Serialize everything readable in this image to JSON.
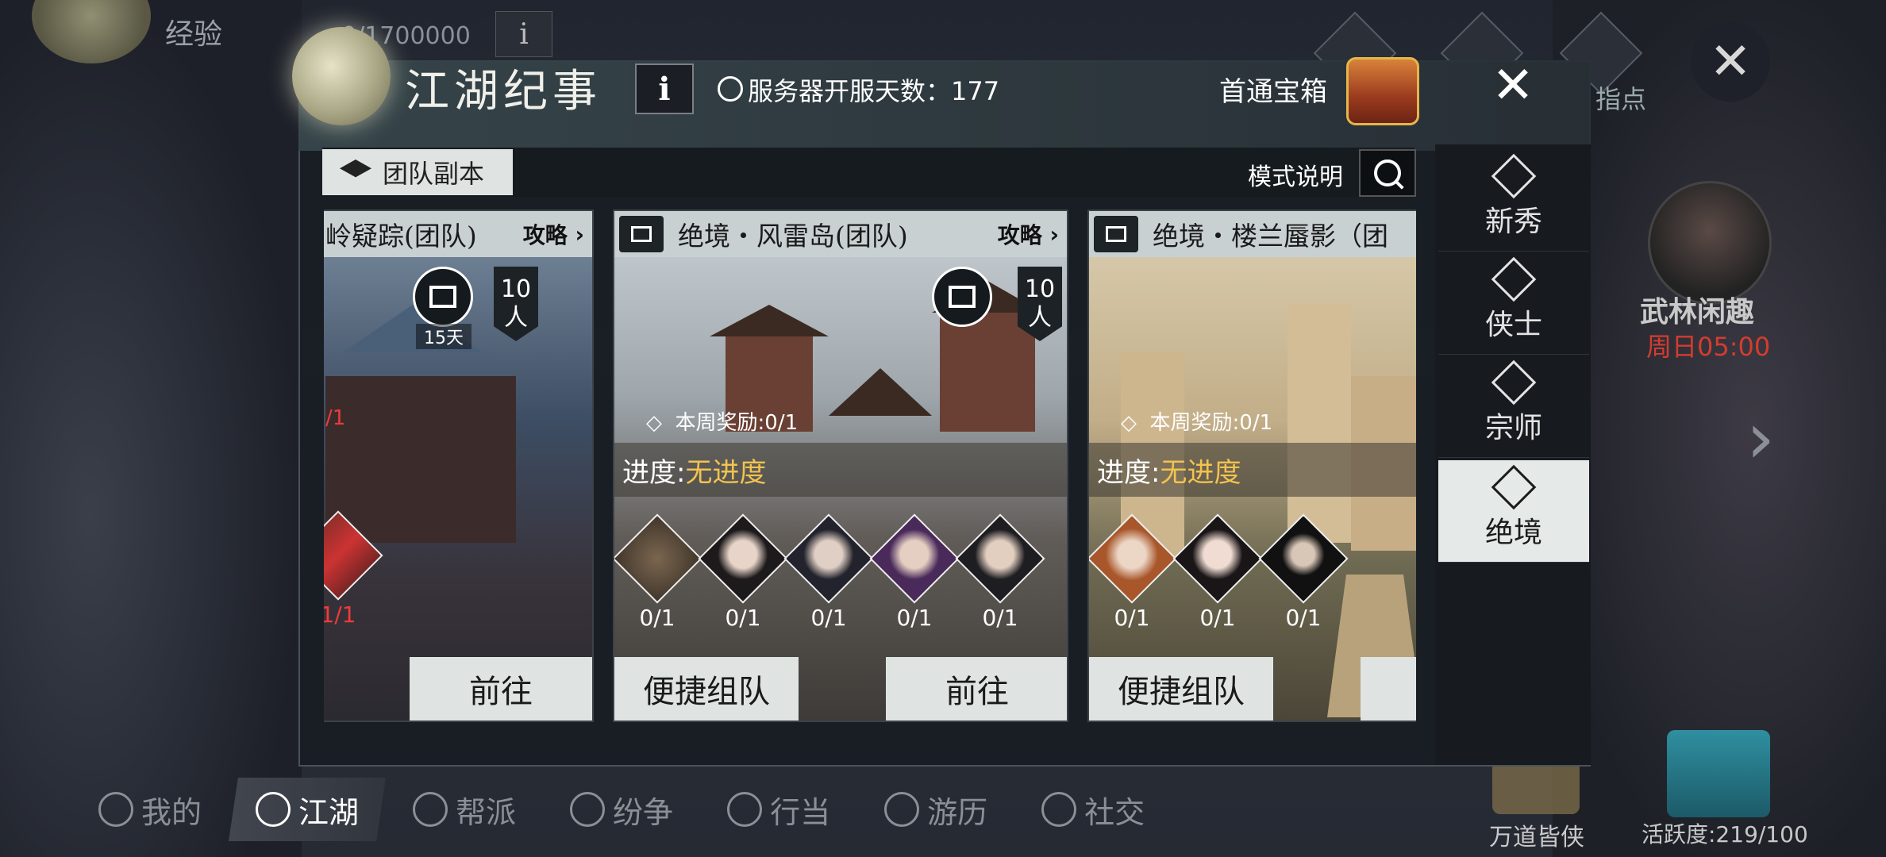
{
  "background": {
    "exp_label": "经验",
    "exp_value": "0/1700000",
    "info_label": "i",
    "close_glyph": "✕",
    "hint_label": "指点",
    "event_name": "武林闲趣",
    "event_time": "周日05:00",
    "chest_label": "万道皆侠",
    "activity": "活跃度:219/100",
    "bottom_nav": [
      {
        "label": "我的",
        "icon": "gear-icon"
      },
      {
        "label": "江湖",
        "icon": "scroll-icon",
        "active": true
      },
      {
        "label": "帮派",
        "icon": "hall-icon"
      },
      {
        "label": "纷争",
        "icon": "swords-icon"
      },
      {
        "label": "行当",
        "icon": "book-icon"
      },
      {
        "label": "游历",
        "icon": "magnifier-icon"
      },
      {
        "label": "社交",
        "icon": "people-icon"
      }
    ]
  },
  "modal": {
    "title": "江湖纪事",
    "info_label": "i",
    "server_days": "服务器开服天数：177",
    "first_clear_chest": "首通宝箱",
    "close_glyph": "✕",
    "tab": "团队副本",
    "mode_help": "模式说明"
  },
  "tiers": [
    {
      "label": "新秀"
    },
    {
      "label": "侠士"
    },
    {
      "label": "宗师"
    },
    {
      "label": "绝境",
      "active": true
    }
  ],
  "cards": [
    {
      "title": "岭疑踪(团队)",
      "guide": "攻略",
      "players": [
        "10",
        "人"
      ],
      "reset_days": "15天",
      "clear_mark": "/1",
      "bosses": [
        "1/1"
      ],
      "buttons": [
        "前往"
      ]
    },
    {
      "title": "绝境・风雷岛(团队)",
      "guide": "攻略",
      "players": [
        "10",
        "人"
      ],
      "weekly_reward": "本周奖励:0/1",
      "progress_label": "进度:",
      "progress_value": "无进度",
      "bosses": [
        "0/1",
        "0/1",
        "0/1",
        "0/1",
        "0/1"
      ],
      "buttons": [
        "便捷组队",
        "前往"
      ]
    },
    {
      "title": "绝境・楼兰蜃影（团",
      "weekly_reward": "本周奖励:0/1",
      "progress_label": "进度:",
      "progress_value": "无进度",
      "bosses": [
        "0/1",
        "0/1",
        "0/1"
      ],
      "buttons": [
        "便捷组队"
      ]
    }
  ],
  "colors": {
    "progress_accent": "#f2c350",
    "cleared_red": "#ef3a3a",
    "event_red": "#d43c30"
  }
}
